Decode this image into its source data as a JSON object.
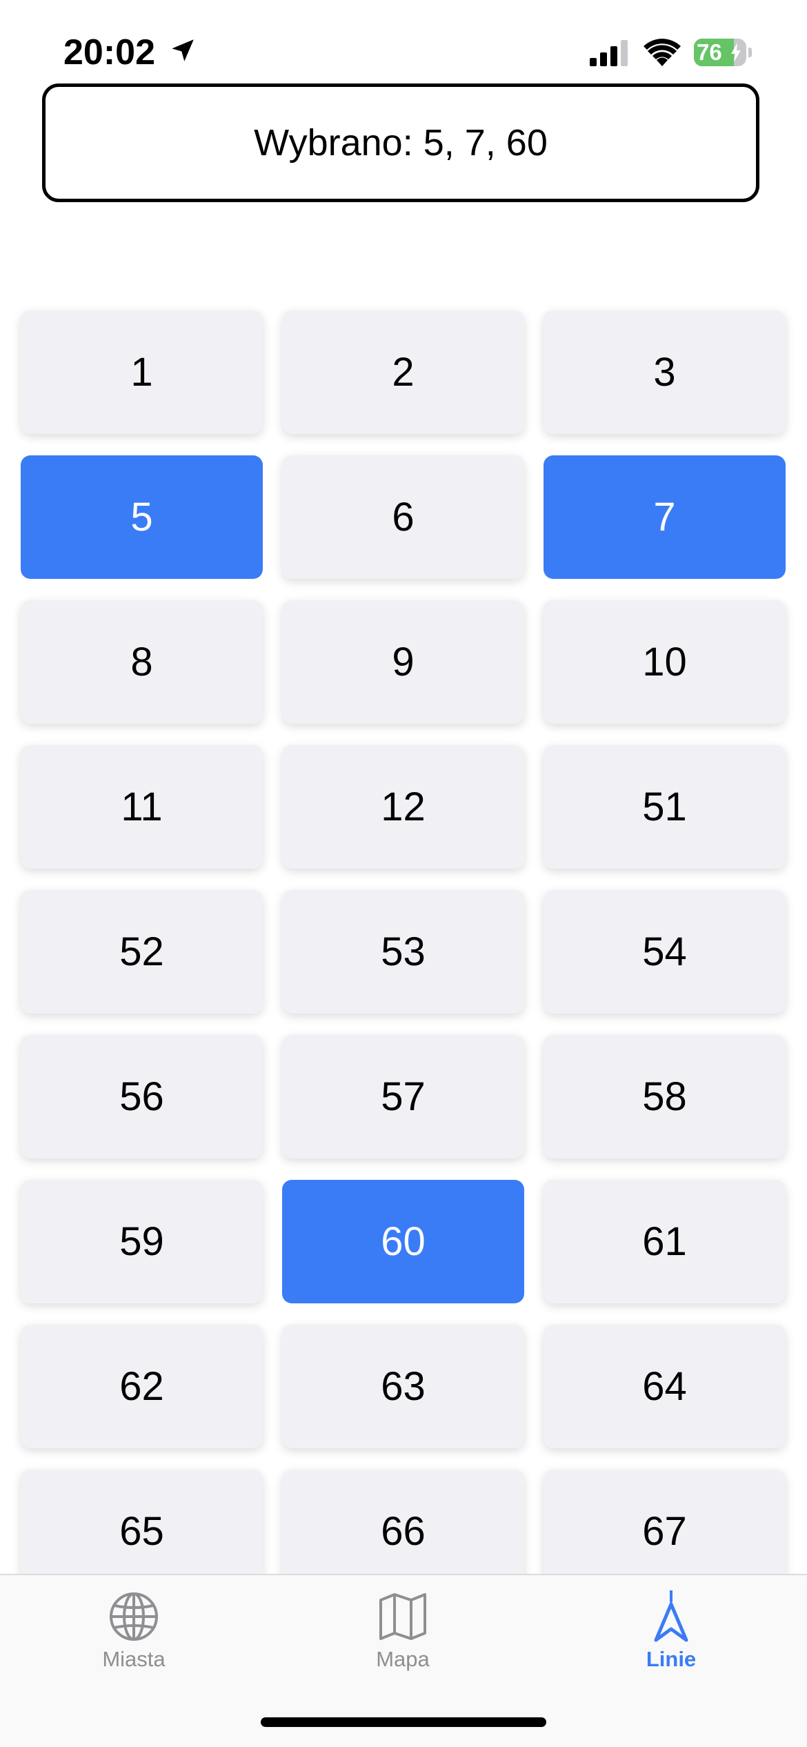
{
  "status_bar": {
    "time": "20:02",
    "battery_level": "76",
    "battery_fraction": 0.76,
    "icons": [
      "location-arrow-icon",
      "cellular-signal-icon",
      "wifi-icon",
      "battery-charging-icon"
    ]
  },
  "selection": {
    "text": "Wybrano: 5, 7, 60"
  },
  "lines": [
    {
      "label": "1",
      "selected": false
    },
    {
      "label": "2",
      "selected": false
    },
    {
      "label": "3",
      "selected": false
    },
    {
      "label": "5",
      "selected": true
    },
    {
      "label": "6",
      "selected": false
    },
    {
      "label": "7",
      "selected": true
    },
    {
      "label": "8",
      "selected": false
    },
    {
      "label": "9",
      "selected": false
    },
    {
      "label": "10",
      "selected": false
    },
    {
      "label": "11",
      "selected": false
    },
    {
      "label": "12",
      "selected": false
    },
    {
      "label": "51",
      "selected": false
    },
    {
      "label": "52",
      "selected": false
    },
    {
      "label": "53",
      "selected": false
    },
    {
      "label": "54",
      "selected": false
    },
    {
      "label": "56",
      "selected": false
    },
    {
      "label": "57",
      "selected": false
    },
    {
      "label": "58",
      "selected": false
    },
    {
      "label": "59",
      "selected": false
    },
    {
      "label": "60",
      "selected": true
    },
    {
      "label": "61",
      "selected": false
    },
    {
      "label": "62",
      "selected": false
    },
    {
      "label": "63",
      "selected": false
    },
    {
      "label": "64",
      "selected": false
    },
    {
      "label": "65",
      "selected": false
    },
    {
      "label": "66",
      "selected": false
    },
    {
      "label": "67",
      "selected": false
    }
  ],
  "tab_bar": {
    "tabs": [
      {
        "label": "Miasta",
        "icon": "globe-icon",
        "active": false
      },
      {
        "label": "Mapa",
        "icon": "map-icon",
        "active": false
      },
      {
        "label": "Linie",
        "icon": "navigation-arrow-icon",
        "active": true
      }
    ]
  },
  "colors": {
    "accent": "#3a7cf6",
    "button_bg": "#f1f1f5",
    "inactive_tab": "#8e8e93",
    "battery_green": "#65c466"
  }
}
